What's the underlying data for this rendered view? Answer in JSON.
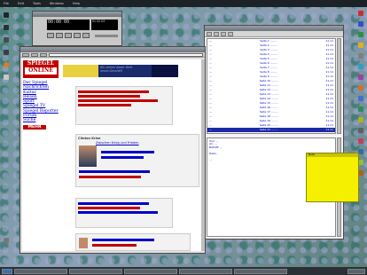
{
  "menubar": {
    "items": [
      "File",
      "Edit",
      "Tools",
      "Windows",
      "Help"
    ]
  },
  "cd_player": {
    "title": "",
    "display": "00:00 00",
    "tracks": "01 02 03"
  },
  "browser": {
    "title": "",
    "url": "",
    "logo_top": "SPIEGEL",
    "logo_bottom": "ONLINE",
    "banner_text": "Wir ziehen dieser Welt",
    "banner_text2": "neues Geschäft",
    "nav_items": [
      "Der Spiegel",
      "Nachrichten",
      "Kultur",
      "Reisen",
      "Sport",
      "Spiegel TV",
      "Spiegel Reporter",
      "Forum",
      "Suche"
    ],
    "mehr_label": "MEHR",
    "section_a_title": "",
    "section_b_title": "Clinton Krise",
    "section_c_title": "",
    "section_b_lead": "Zwischen Krieg und Frieden"
  },
  "news_window": {
    "title": "",
    "list_rows": [
      [
        "—",
        "Seite 1 .........",
        "11.11"
      ],
      [
        "—",
        "Seite 2 .........",
        "11.11"
      ],
      [
        "—",
        "Seite 3 .........",
        "11.11"
      ],
      [
        "—",
        "Seite 4 .........",
        "11.11"
      ],
      [
        "—",
        "Seite 5 .........",
        "11.11"
      ],
      [
        "—",
        "Seite 6 .........",
        "11.11"
      ],
      [
        "—",
        "Seite 7 .........",
        "11.11"
      ],
      [
        "—",
        "Seite 8 .........",
        "11.11"
      ],
      [
        "—",
        "Seite 9 .........",
        "11.11"
      ],
      [
        "—",
        "Seite 10 ........",
        "11.11"
      ],
      [
        "—",
        "Seite 11 ........",
        "11.11"
      ],
      [
        "—",
        "Seite 12 ........",
        "11.11"
      ],
      [
        "—",
        "Seite 13 ........",
        "11.11"
      ],
      [
        "—",
        "Seite 14 ........",
        "11.11"
      ],
      [
        "—",
        "Seite 15 ........",
        "11.11"
      ],
      [
        "—",
        "Seite 16 ........",
        "11.11"
      ],
      [
        "—",
        "Seite 17 ........",
        "11.11"
      ],
      [
        "—",
        "Seite 18 ........",
        "11.11"
      ],
      [
        "—",
        "Seite 19 ........",
        "11.11"
      ],
      [
        "—",
        "Seite 20 ........",
        "11.11"
      ],
      [
        "—",
        "Seite 21 ........",
        "11.11"
      ]
    ],
    "selected_index": 20,
    "body_lines": [
      "Von: ...",
      "An: ...",
      "Betreff: ...",
      "",
      "Hallo,",
      "",
      "..."
    ]
  },
  "sticky_note": {
    "title": "Note",
    "text": ""
  },
  "taskbar": {
    "items": [
      "",
      "",
      "",
      "",
      "",
      ""
    ]
  },
  "colors": {
    "accent_red": "#c00000",
    "link_blue": "#0000c8",
    "sticky": "#f4f000",
    "selection": "#1a2aa6"
  }
}
